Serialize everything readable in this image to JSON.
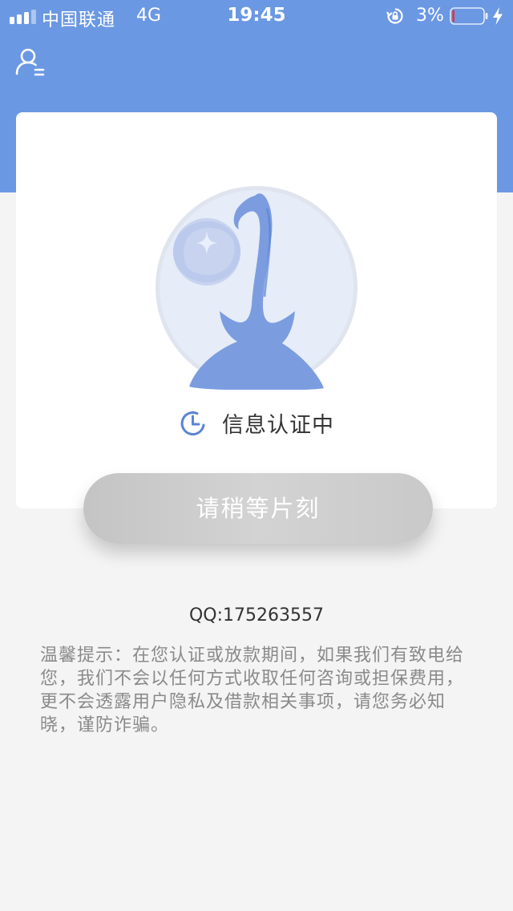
{
  "status_bar": {
    "carrier": "中国联通",
    "network": "4G",
    "time": "19:45",
    "battery_percent": "3%",
    "battery_level": 0.03,
    "status_bar_color": "#6b98e3"
  },
  "header": {
    "user_icon": "user-menu-icon",
    "brand_color": "#6b98e3"
  },
  "card": {
    "illustration": "money-bag-illustration",
    "status_icon": "clock-icon",
    "status_text": "信息认证中"
  },
  "button": {
    "label": "请稍等片刻",
    "color": "#c9c9c9"
  },
  "contact": {
    "qq": "QQ:175263557"
  },
  "notice": {
    "text": "温馨提示：在您认证或放款期间，如果我们有致电给您，我们不会以任何方式收取任何咨询或担保费用，更不会透露用户隐私及借款相关事项，请您务必知晓，谨防诈骗。"
  }
}
